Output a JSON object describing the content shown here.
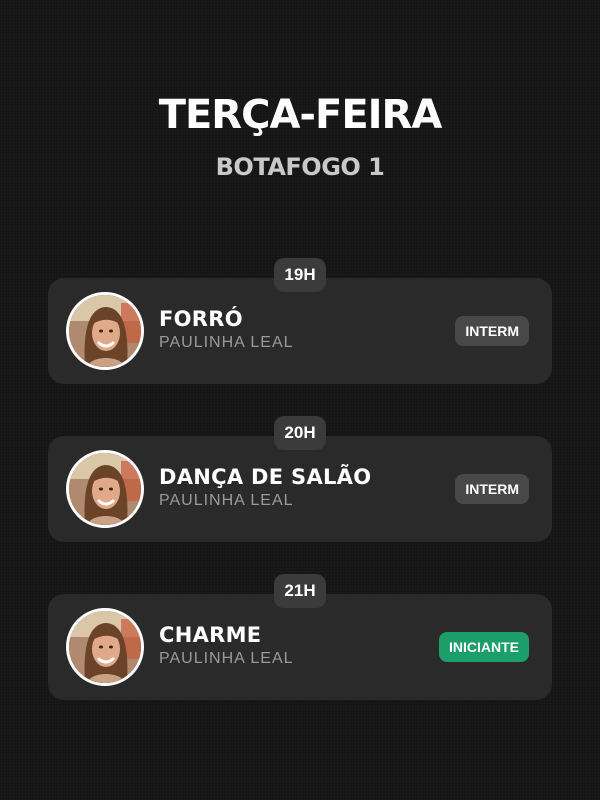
{
  "header": {
    "title": "TERÇA-FEIRA",
    "subtitle": "BOTAFOGO 1"
  },
  "classes": [
    {
      "time": "19H",
      "name": "FORRÓ",
      "teacher": "PAULINHA LEAL",
      "level": "INTERM",
      "level_color": "#484848"
    },
    {
      "time": "20H",
      "name": "DANÇA DE SALÃO",
      "teacher": "PAULINHA LEAL",
      "level": "INTERM",
      "level_color": "#484848"
    },
    {
      "time": "21H",
      "name": "CHARME",
      "teacher": "PAULINHA LEAL",
      "level": "INICIANTE",
      "level_color": "#1c9e6b"
    }
  ],
  "colors": {
    "background": "#151515",
    "card": "#2a2a2a",
    "chip": "#3b3b3b",
    "subtitle": "#c9c9c9",
    "teacher": "#9a9a9a"
  }
}
